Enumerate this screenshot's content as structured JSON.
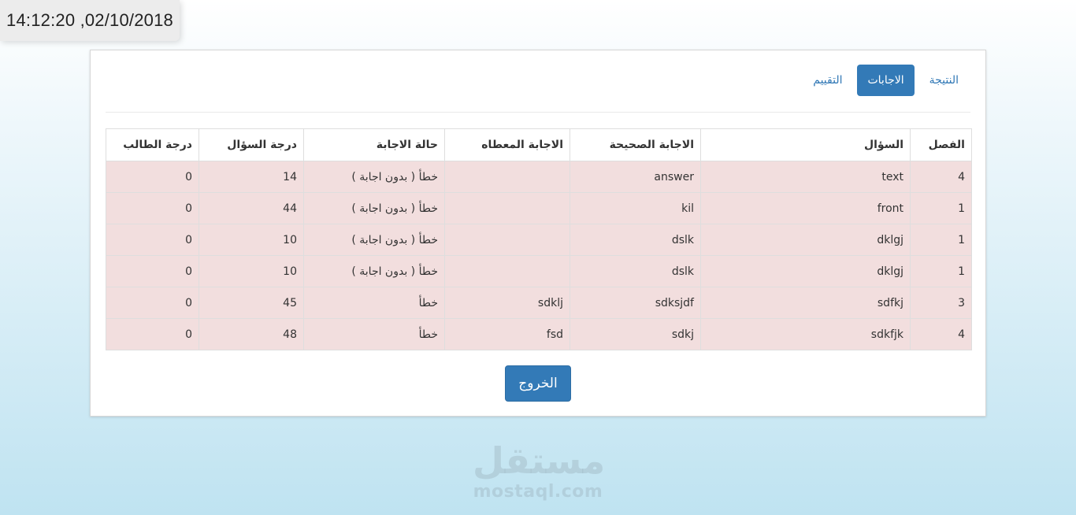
{
  "clock": {
    "datetime": "14:12:20  ,02/10/2018"
  },
  "tabs": [
    {
      "label": "النتيجة",
      "active": false
    },
    {
      "label": "الاجابات",
      "active": true
    },
    {
      "label": "التقييم",
      "active": false
    }
  ],
  "table": {
    "headers": [
      "الفصل",
      "السؤال",
      "الاجابة الصحيحة",
      "الاجابة المعطاه",
      "حالة الاجابة",
      "درجة السؤال",
      "درجة الطالب"
    ],
    "rows": [
      [
        "4",
        "text",
        "answer",
        "",
        "خطأ ( بدون اجابة )",
        "14",
        "0"
      ],
      [
        "1",
        "front",
        "kil",
        "",
        "خطأ ( بدون اجابة )",
        "44",
        "0"
      ],
      [
        "1",
        "dklgj",
        "dslk",
        "",
        "خطأ ( بدون اجابة )",
        "10",
        "0"
      ],
      [
        "1",
        "dklgj",
        "dslk",
        "",
        "خطأ ( بدون اجابة )",
        "10",
        "0"
      ],
      [
        "3",
        "sdfkj",
        "sdksjdf",
        "sdklj",
        "خطأ",
        "45",
        "0"
      ],
      [
        "4",
        "sdkfjk",
        "sdkj",
        "fsd",
        "خطأ",
        "48",
        "0"
      ]
    ]
  },
  "exit_button": {
    "label": "الخروج"
  },
  "watermark": {
    "ar": "مستقل",
    "en": "mostaql.com"
  },
  "colors": {
    "accent": "#337ab7",
    "row_error_bg": "#f2dede",
    "background_bottom": "#bfe3f1"
  }
}
